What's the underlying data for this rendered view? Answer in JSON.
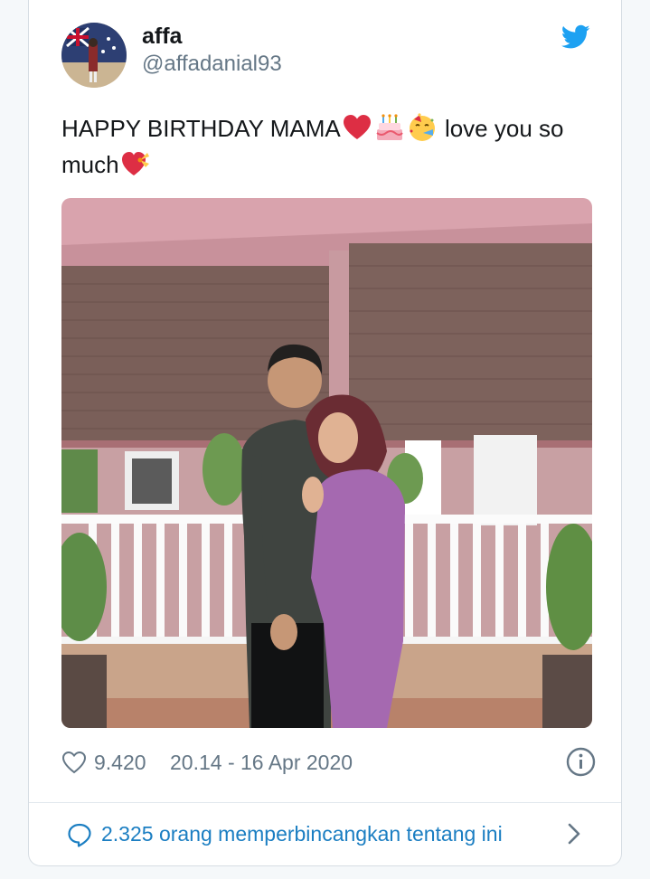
{
  "tweet": {
    "display_name": "affa",
    "handle": "@affadanial93",
    "text_part1": "HAPPY BIRTHDAY MAMA",
    "text_part2": " love you so much",
    "emojis": [
      "red-heart",
      "birthday-cake",
      "partying-face",
      "heart-with-ribbon"
    ],
    "like_count": "9.420",
    "timestamp": "20.14 - 16 Apr 2020",
    "discussion_label": "2.325 orang memperbincangkan tentang ini"
  },
  "colors": {
    "twitter_blue": "#1da1f2",
    "link_blue": "#1b7ec2",
    "muted_gray": "#657786"
  }
}
